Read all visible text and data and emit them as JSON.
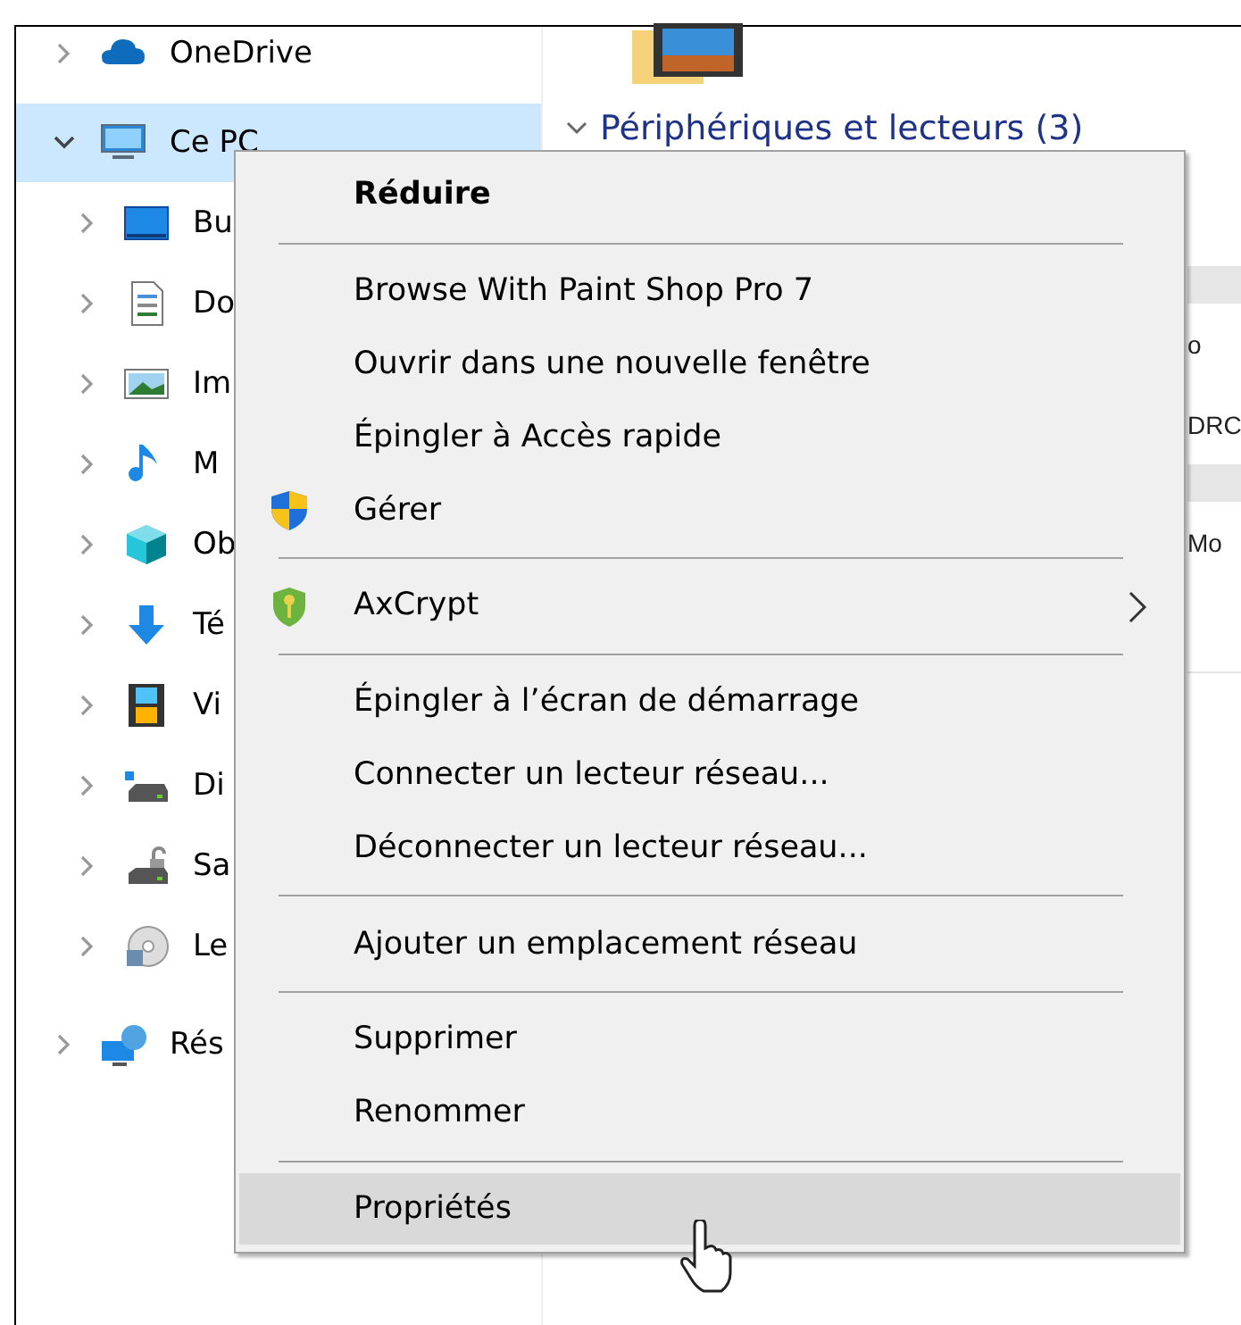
{
  "navigation_pane": {
    "items": [
      {
        "label": "OneDrive",
        "kind": "cloud",
        "expanded": false,
        "selected": false
      },
      {
        "label": "Ce PC",
        "kind": "computer",
        "expanded": true,
        "selected": true,
        "children": [
          {
            "label": "Bu",
            "kind": "desktop",
            "expanded": false,
            "selected": false
          },
          {
            "label": "Do",
            "kind": "document",
            "expanded": false,
            "selected": false
          },
          {
            "label": "Im",
            "kind": "pictures",
            "expanded": false,
            "selected": false
          },
          {
            "label": "M",
            "kind": "music",
            "expanded": false,
            "selected": false
          },
          {
            "label": "Ob",
            "kind": "objects3d",
            "expanded": false,
            "selected": false
          },
          {
            "label": "Té",
            "kind": "download",
            "expanded": false,
            "selected": false
          },
          {
            "label": "Vi",
            "kind": "video",
            "expanded": false,
            "selected": false
          },
          {
            "label": "Di",
            "kind": "drive",
            "expanded": false,
            "selected": false
          },
          {
            "label": "Sa",
            "kind": "drive-lock",
            "expanded": false,
            "selected": false
          },
          {
            "label": "Le",
            "kind": "disc",
            "expanded": false,
            "selected": false
          }
        ]
      },
      {
        "label": "Rés",
        "kind": "network",
        "expanded": false,
        "selected": false
      }
    ]
  },
  "content": {
    "section_heading": "Périphériques et lecteurs (3)",
    "expanded": true,
    "fragments": [
      "o",
      "DRC",
      "Mo"
    ]
  },
  "context_menu": {
    "items": [
      {
        "kind": "item",
        "label": "Réduire",
        "bold": true,
        "selected": false
      },
      {
        "kind": "separator"
      },
      {
        "kind": "item",
        "label": "Browse With Paint Shop Pro 7",
        "bold": false,
        "selected": false
      },
      {
        "kind": "item",
        "label": "Ouvrir dans une nouvelle fenêtre",
        "bold": false,
        "selected": false
      },
      {
        "kind": "item",
        "label": "Épingler à Accès rapide",
        "bold": false,
        "selected": false
      },
      {
        "kind": "item",
        "label": "Gérer",
        "bold": false,
        "selected": false
      },
      {
        "kind": "separator"
      },
      {
        "kind": "item",
        "label": "AxCrypt",
        "submenu": true,
        "bold": false,
        "selected": false
      },
      {
        "kind": "separator"
      },
      {
        "kind": "item",
        "label": "Épingler à l’écran de démarrage",
        "bold": false,
        "selected": false
      },
      {
        "kind": "item",
        "label": "Connecter un lecteur réseau...",
        "bold": false,
        "selected": false
      },
      {
        "kind": "item",
        "label": "Déconnecter un lecteur réseau...",
        "bold": false,
        "selected": false
      },
      {
        "kind": "separator"
      },
      {
        "kind": "item",
        "label": "Ajouter un emplacement réseau",
        "bold": false,
        "selected": false
      },
      {
        "kind": "separator"
      },
      {
        "kind": "item",
        "label": "Supprimer",
        "bold": false,
        "selected": false
      },
      {
        "kind": "item",
        "label": "Renommer",
        "bold": false,
        "selected": false
      },
      {
        "kind": "separator"
      },
      {
        "kind": "item",
        "label": "Propriétés",
        "bold": false,
        "selected": true
      }
    ]
  }
}
